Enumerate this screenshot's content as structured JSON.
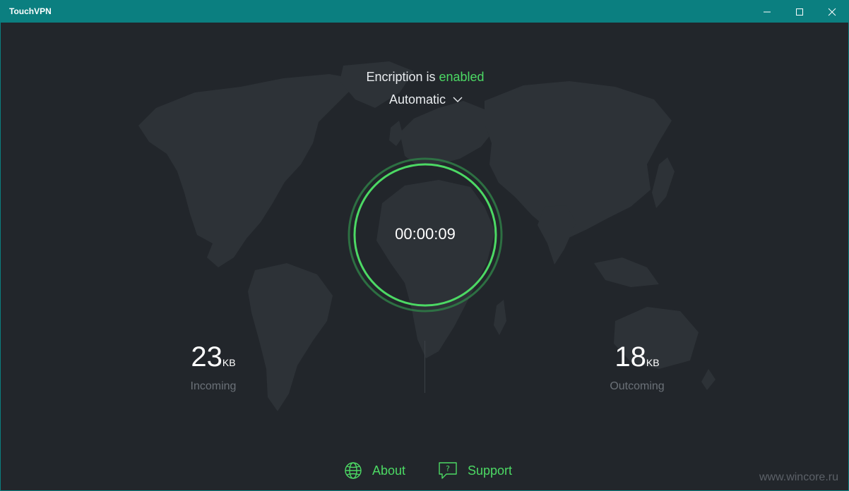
{
  "window": {
    "title": "TouchVPN",
    "controls": [
      "minimize-icon",
      "maximize-icon",
      "close-icon"
    ]
  },
  "encryption": {
    "prefix": "Encription is ",
    "status": "enabled",
    "mode": "Automatic"
  },
  "timer": "00:00:09",
  "stats": {
    "incoming": {
      "value": "23",
      "unit": "KB",
      "label": "Incoming"
    },
    "outgoing": {
      "value": "18",
      "unit": "KB",
      "label": "Outcoming"
    }
  },
  "footer": {
    "about": "About",
    "support": "Support"
  },
  "watermark": "www.wincore.ru",
  "colors": {
    "titlebar": "#0b7f80",
    "background": "#22262b",
    "accent": "#4cd964",
    "map": "#2e3338"
  }
}
